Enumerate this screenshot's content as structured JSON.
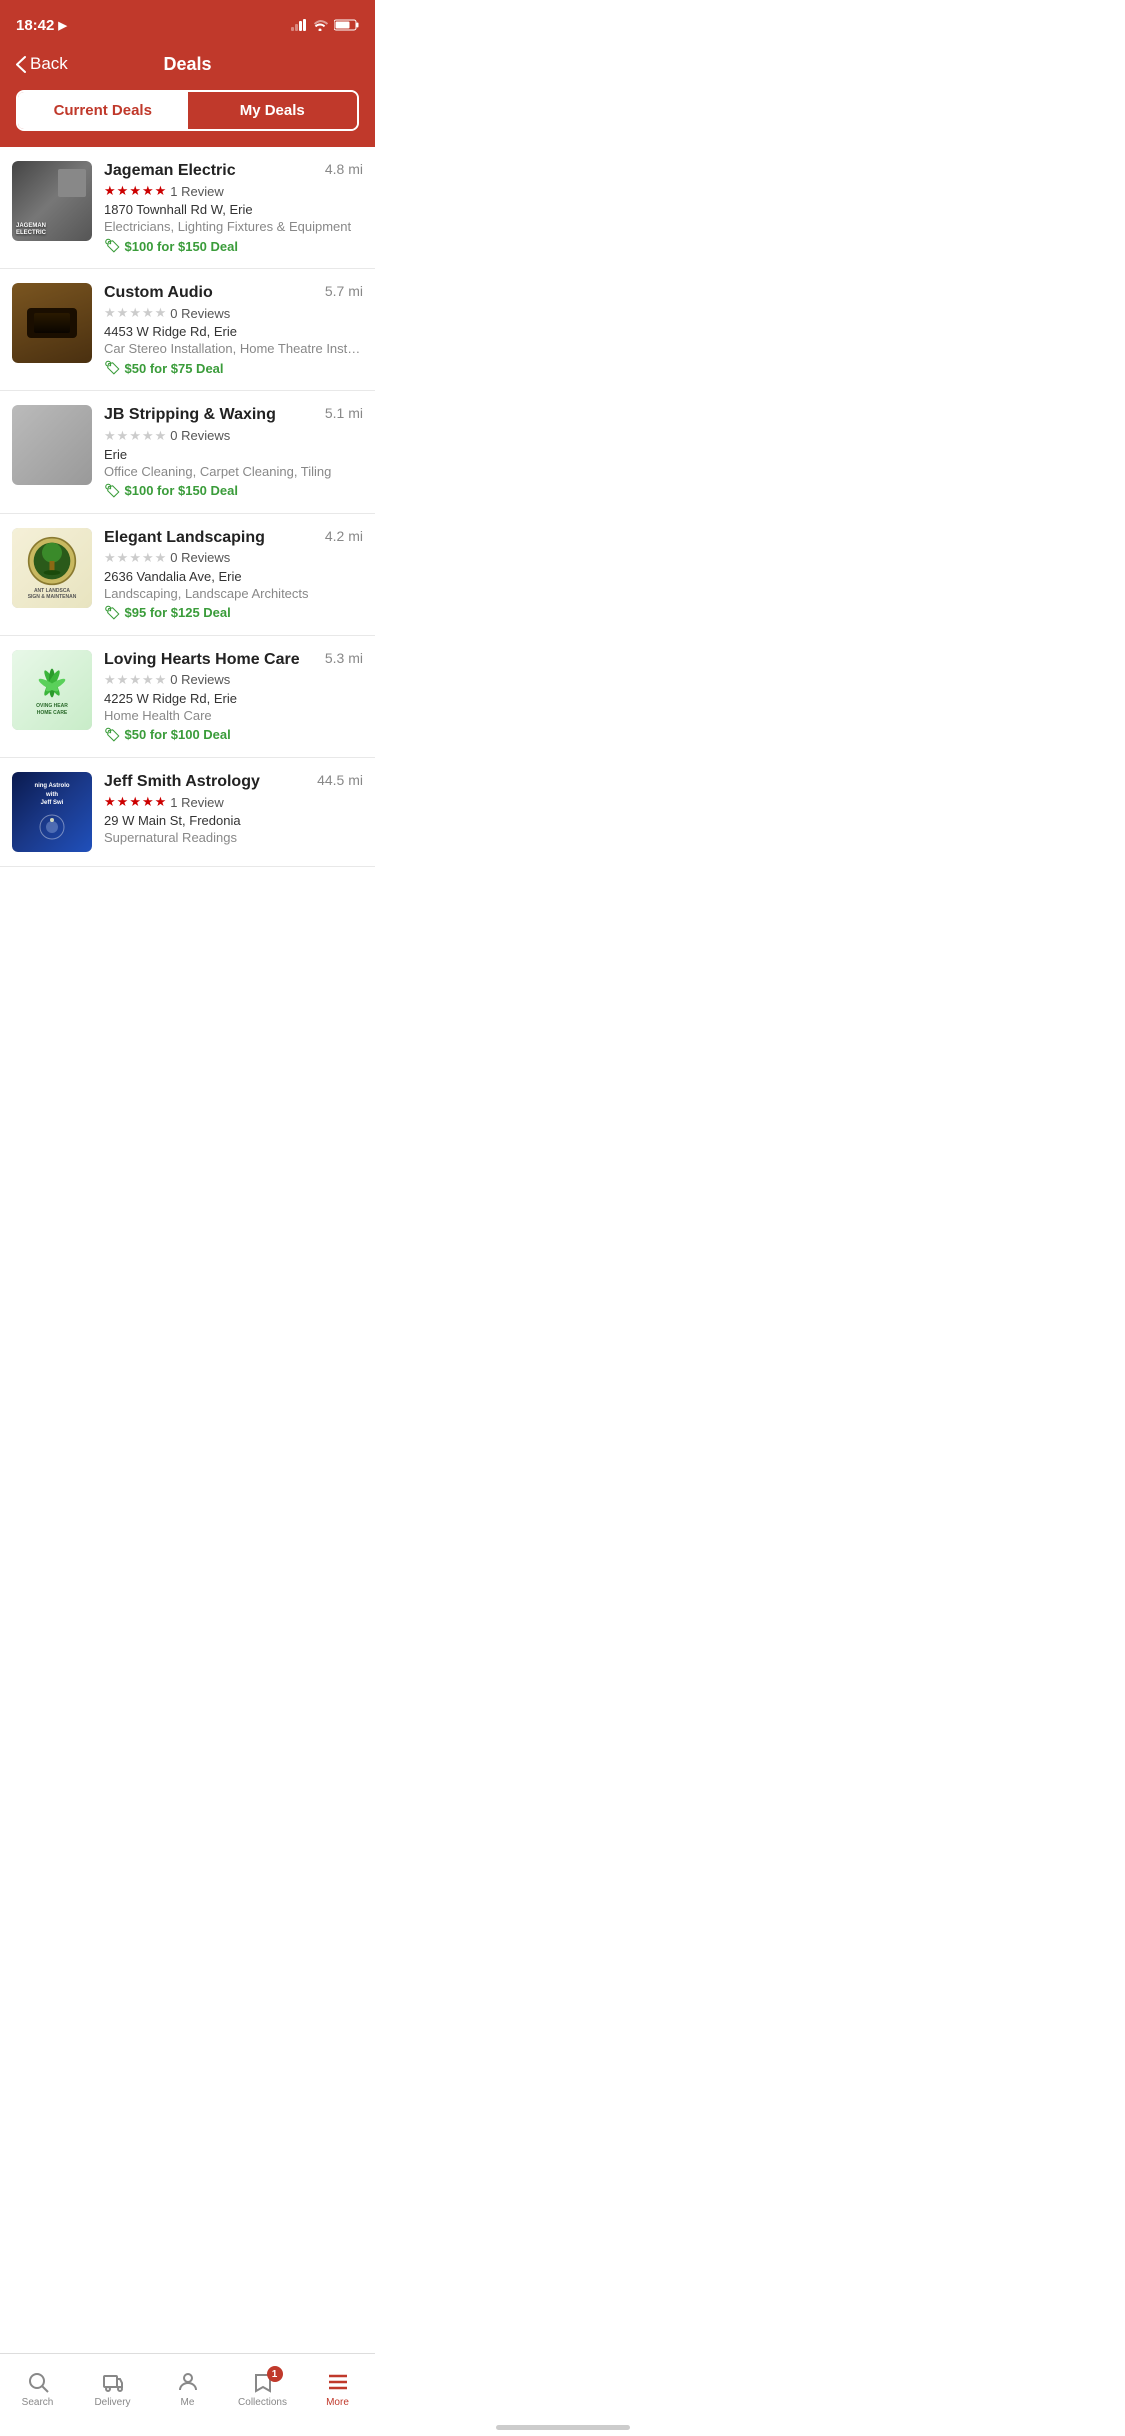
{
  "statusBar": {
    "time": "18:42",
    "locationIcon": "▶"
  },
  "header": {
    "backLabel": "Back",
    "title": "Deals"
  },
  "tabs": {
    "currentDeals": "Current Deals",
    "myDeals": "My Deals",
    "activeTab": "myDeals"
  },
  "deals": [
    {
      "id": "jageman",
      "name": "Jageman Electric",
      "distance": "4.8 mi",
      "stars": 5,
      "reviewCount": "1 Review",
      "address": "1870 Townhall Rd W, Erie",
      "category": "Electricians, Lighting Fixtures & Equipment",
      "deal": "$100 for $150 Deal",
      "imageType": "jageman"
    },
    {
      "id": "custom-audio",
      "name": "Custom Audio",
      "distance": "5.7 mi",
      "stars": 0,
      "reviewCount": "0 Reviews",
      "address": "4453 W Ridge Rd, Erie",
      "category": "Car Stereo Installation, Home Theatre Installa...",
      "deal": "$50 for $75 Deal",
      "imageType": "audio"
    },
    {
      "id": "jb-stripping",
      "name": "JB Stripping & Waxing",
      "distance": "5.1 mi",
      "stars": 0,
      "reviewCount": "0 Reviews",
      "address": "Erie",
      "category": "Office Cleaning, Carpet Cleaning, Tiling",
      "deal": "$100 for $150 Deal",
      "imageType": "stripping"
    },
    {
      "id": "elegant-landscaping",
      "name": "Elegant Landscaping",
      "distance": "4.2 mi",
      "stars": 0,
      "reviewCount": "0 Reviews",
      "address": "2636 Vandalia Ave, Erie",
      "category": "Landscaping, Landscape Architects",
      "deal": "$95 for $125 Deal",
      "imageType": "landscaping"
    },
    {
      "id": "loving-hearts",
      "name": "Loving Hearts Home Care",
      "distance": "5.3 mi",
      "stars": 0,
      "reviewCount": "0 Reviews",
      "address": "4225 W Ridge Rd, Erie",
      "category": "Home Health Care",
      "deal": "$50 for $100 Deal",
      "imageType": "lovingheart"
    },
    {
      "id": "jeff-smith",
      "name": "Jeff Smith Astrology",
      "distance": "44.5 mi",
      "stars": 5,
      "reviewCount": "1 Review",
      "address": "29 W Main St, Fredonia",
      "category": "Supernatural Readings",
      "deal": "",
      "imageType": "astrology"
    }
  ],
  "bottomNav": {
    "items": [
      {
        "id": "search",
        "label": "Search",
        "active": false,
        "badge": null
      },
      {
        "id": "delivery",
        "label": "Delivery",
        "active": false,
        "badge": null
      },
      {
        "id": "me",
        "label": "Me",
        "active": false,
        "badge": null
      },
      {
        "id": "collections",
        "label": "Collections",
        "active": false,
        "badge": "1"
      },
      {
        "id": "more",
        "label": "More",
        "active": true,
        "badge": null
      }
    ]
  }
}
